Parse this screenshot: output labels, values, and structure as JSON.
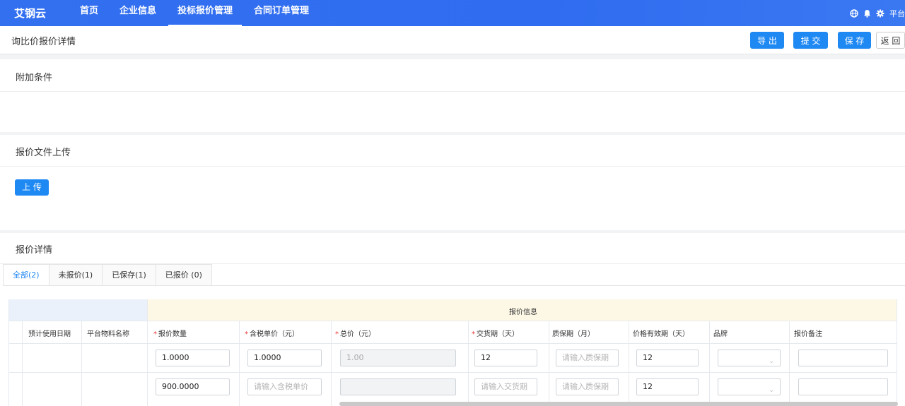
{
  "app": {
    "logo": "艾钢云",
    "nav": [
      "首页",
      "企业信息",
      "投标报价管理",
      "合同订单管理"
    ],
    "active_nav": "投标报价管理",
    "platform_label": "平台"
  },
  "page": {
    "title": "询比价报价详情",
    "buttons": {
      "export": "导 出",
      "submit": "提 交",
      "save": "保 存",
      "back": "返 回"
    }
  },
  "sections": {
    "conditions": {
      "title": "附加条件"
    },
    "upload": {
      "title": "报价文件上传",
      "upload_button": "上 传"
    },
    "details": {
      "title": "报价详情"
    }
  },
  "tabs": [
    {
      "label": "全部(2)",
      "active": true
    },
    {
      "label": "未报价(1)",
      "active": false
    },
    {
      "label": "已保存(1)",
      "active": false
    },
    {
      "label": "已报价 (0)",
      "active": false
    }
  ],
  "table": {
    "group_header": "报价信息",
    "columns": {
      "expected_date": "预计使用日期",
      "material_name": "平台物料名称",
      "quantity": "报价数量",
      "unit_price": "含税单价（元）",
      "total": "总价（元）",
      "delivery": "交货期（天）",
      "warranty": "质保期（月）",
      "validity": "价格有效期（天）",
      "brand": "品牌",
      "remark": "报价备注"
    },
    "required_mark": "*",
    "rows": [
      {
        "quantity": "1.0000",
        "unit_price": "1.0000",
        "total": "1.00",
        "delivery": "12",
        "warranty_placeholder": "请输入质保期",
        "validity": "12",
        "brand": "",
        "remark": ""
      },
      {
        "quantity": "900.0000",
        "unit_price_placeholder": "请输入含税单价",
        "total": "",
        "delivery_placeholder": "请输入交货期",
        "warranty_placeholder": "请输入质保期",
        "validity": "12",
        "brand": "",
        "remark": ""
      }
    ]
  },
  "icons": [
    "globe-icon",
    "bell-icon",
    "settings-icon",
    "chevron-down-icon"
  ],
  "colors": {
    "nav_bg": "#2f6cf0",
    "primary": "#1e88f3",
    "group_header_bg": "#fdf8e6",
    "required": "#e33333"
  }
}
